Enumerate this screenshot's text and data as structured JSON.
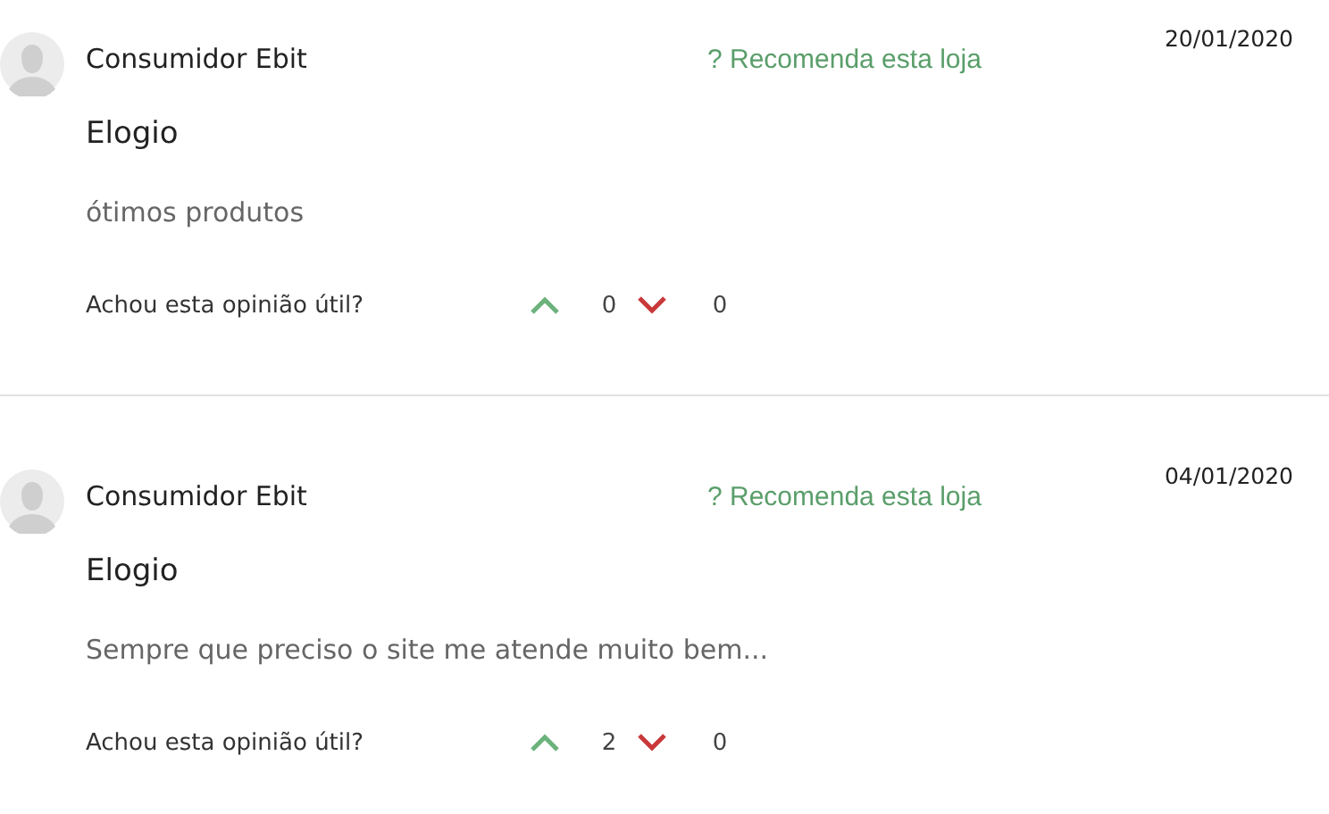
{
  "reviews": [
    {
      "author": "Consumidor Ebit",
      "recommendation": "? Recomenda esta loja",
      "date": "20/01/2020",
      "title": "Elogio",
      "body": "ótimos produtos",
      "helpful_label": "Achou esta opinião útil?",
      "up_count": "0",
      "down_count": "0"
    },
    {
      "author": "Consumidor Ebit",
      "recommendation": "? Recomenda esta loja",
      "date": "04/01/2020",
      "title": "Elogio",
      "body": "Sempre que preciso o site me atende muito bem...",
      "helpful_label": "Achou esta opinião útil?",
      "up_count": "2",
      "down_count": "0"
    }
  ]
}
